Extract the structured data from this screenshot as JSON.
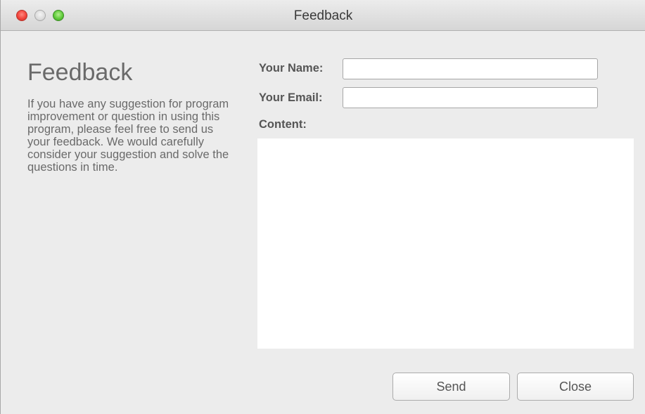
{
  "window": {
    "title": "Feedback",
    "controls": [
      "close",
      "minimize",
      "maximize"
    ]
  },
  "intro": {
    "heading": "Feedback",
    "description": "If you have any suggestion for program improvement or question in using this program, please feel free to send us your feedback. We would carefully consider your suggestion and solve the questions in time."
  },
  "form": {
    "name_label": "Your Name:",
    "name_value": "",
    "email_label": "Your Email:",
    "email_value": "",
    "content_label": "Content:",
    "content_value": ""
  },
  "buttons": {
    "send_label": "Send",
    "close_label": "Close"
  },
  "colors": {
    "close_button": "#f2453d",
    "minimize_button": "#dcdcdc",
    "maximize_button": "#5fcb3a",
    "window_background": "#ececec"
  }
}
